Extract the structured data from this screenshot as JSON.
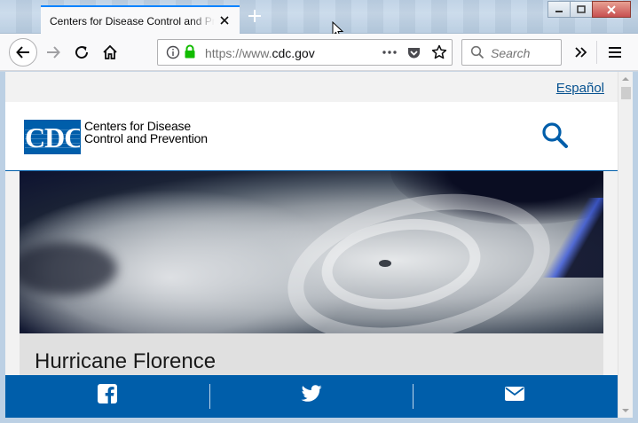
{
  "browser": {
    "tab_title": "Centers for Disease Control and Prevention",
    "url_scheme": "https://www.",
    "url_host": "cdc.gov",
    "search_placeholder": "Search"
  },
  "page": {
    "language_link": "Español",
    "logo_text": "CDC",
    "agency_name_line1": "Centers for Disease",
    "agency_name_line2": "Control and Prevention",
    "headline": "Hurricane Florence",
    "share_buttons": [
      "facebook-icon",
      "twitter-icon",
      "email-icon"
    ]
  },
  "colors": {
    "brand_blue": "#005eaa",
    "link_blue": "#075290",
    "tab_accent": "#0a84ff",
    "secure_green": "#12bc00"
  }
}
